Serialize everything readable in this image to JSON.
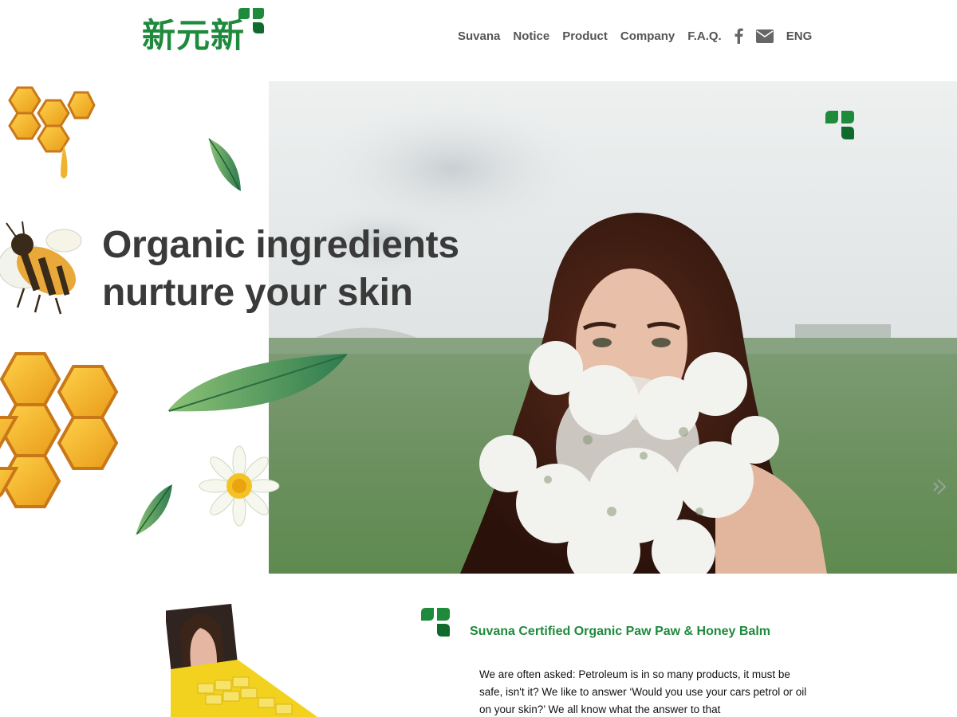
{
  "brand": {
    "logo_text": "新元新",
    "green": "#1e8a3c",
    "dark_green": "#0f6a2c"
  },
  "nav": {
    "items": [
      "Suvana",
      "Notice",
      "Product",
      "Company",
      "F.A.Q."
    ],
    "facebook_icon": "facebook-icon",
    "mail_icon": "envelope-icon",
    "language": "ENG"
  },
  "hero": {
    "heading_line1": "Organic ingredients",
    "heading_line2": "nurture your skin",
    "image": "woman-with-white-flowers-in-field",
    "illustrations": [
      "honeycomb",
      "bee",
      "leaf",
      "daisy"
    ]
  },
  "product": {
    "title": "Suvana Certified Organic Paw Paw & Honey Balm",
    "body": "We are often asked: Petroleum is in so many products, it must be safe, isn't it? We like to answer ‘Would you use your cars petrol or oil on your skin?’ We all know what the answer to that"
  }
}
